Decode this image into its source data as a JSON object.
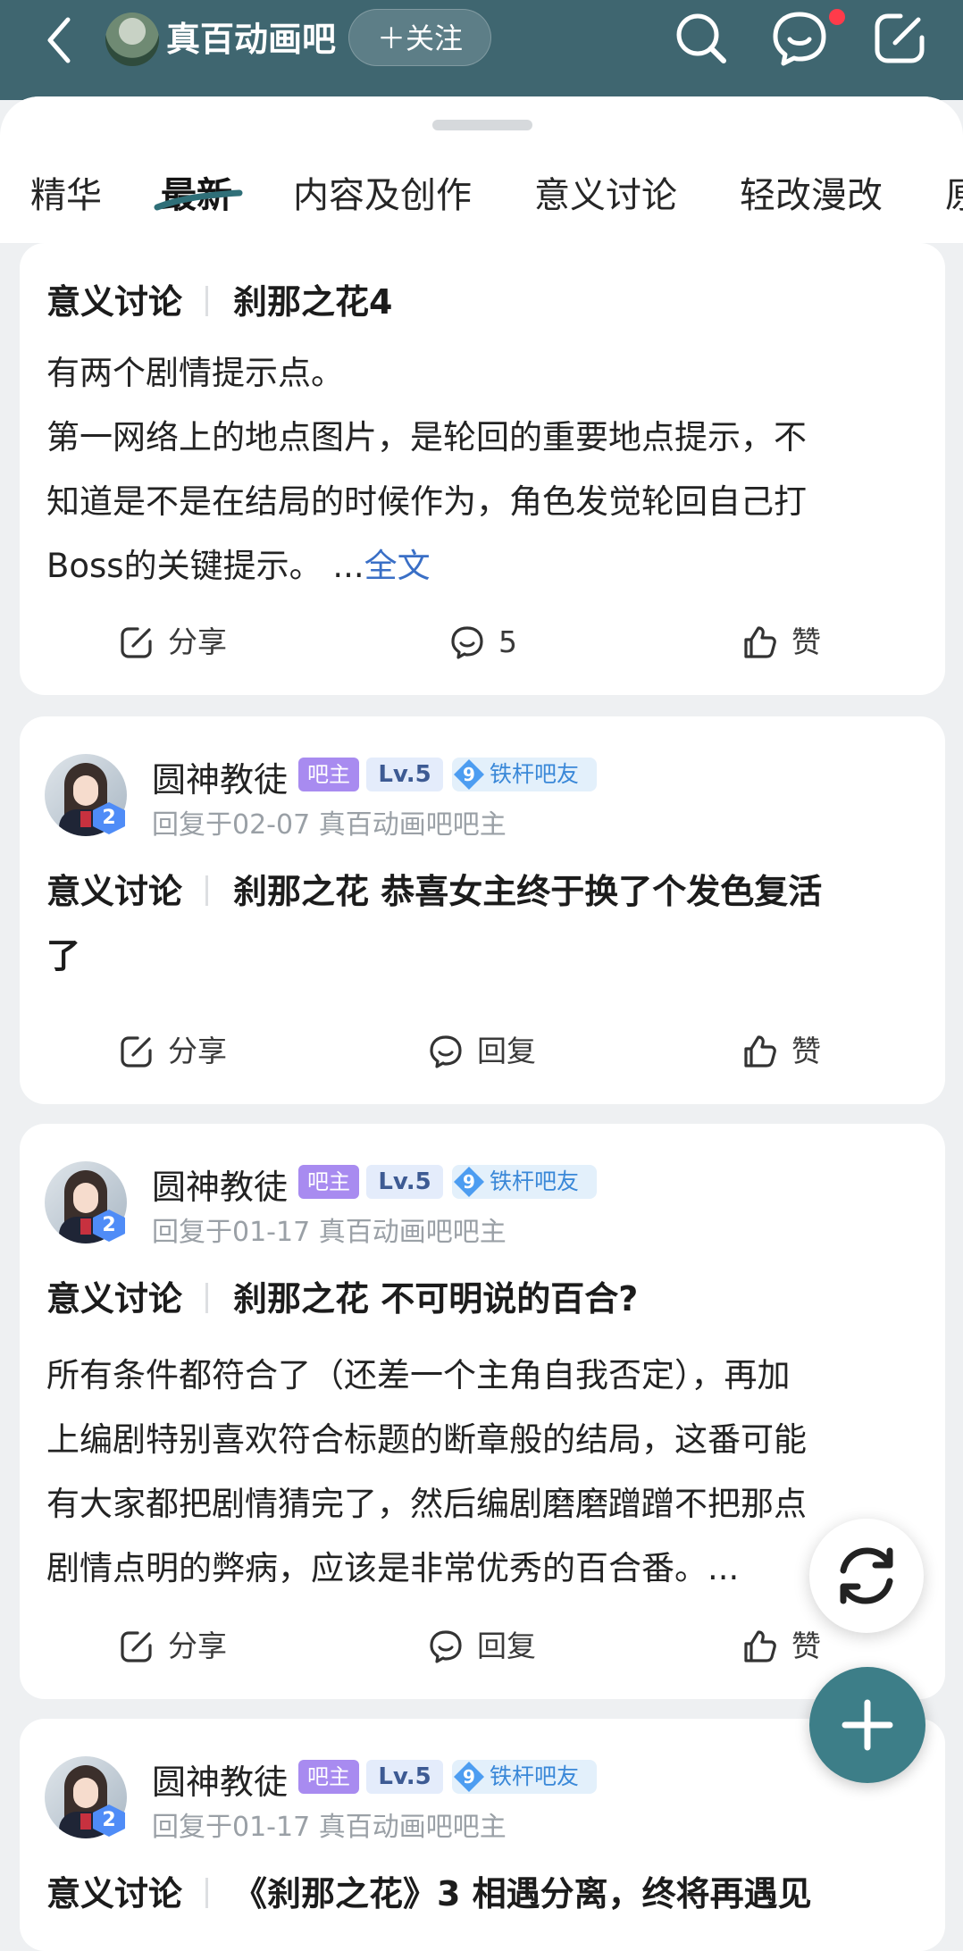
{
  "header": {
    "forum_name": "真百动画吧",
    "follow_label": "＋关注",
    "has_notification": true
  },
  "tabs": [
    {
      "label": "精华"
    },
    {
      "label": "最新"
    },
    {
      "label": "内容及创作"
    },
    {
      "label": "意义讨论"
    },
    {
      "label": "轻改漫改"
    },
    {
      "label": "原"
    }
  ],
  "active_tab": "最新",
  "posts": [
    {
      "category": "意义讨论",
      "title": "刹那之花4",
      "body_lines": [
        "有两个剧情提示点。",
        "第一网络上的地点图片，是轮回的重要地点提示，不",
        "知道是不是在结局的时候作为，角色发觉轮回自己打"
      ],
      "body_last": "Boss的关键提示。 ...",
      "more_label": "全文",
      "share_label": "分享",
      "comment_label": "5",
      "like_label": "赞"
    },
    {
      "user": "圆神教徒",
      "owner_tag": "吧主",
      "level_tag": "Lv.5",
      "fan_level": "9",
      "fan_tag": "铁杆吧友",
      "avatar_badge": "2",
      "meta": "回复于02-07   真百动画吧吧主",
      "category": "意义讨论",
      "title_line1": "刹那之花 恭喜女主终于换了个发色复活",
      "title_line2": "了",
      "share_label": "分享",
      "comment_label": "回复",
      "like_label": "赞"
    },
    {
      "user": "圆神教徒",
      "owner_tag": "吧主",
      "level_tag": "Lv.5",
      "fan_level": "9",
      "fan_tag": "铁杆吧友",
      "avatar_badge": "2",
      "meta": "回复于01-17   真百动画吧吧主",
      "category": "意义讨论",
      "title": "刹那之花 不可明说的百合?",
      "body_lines": [
        "所有条件都符合了（还差一个主角自我否定），再加",
        "上编剧特别喜欢符合标题的断章般的结局，这番可能",
        "有大家都把剧情猜完了，然后编剧磨磨蹭蹭不把那点",
        "剧情点明的弊病，应该是非常优秀的百合番。..."
      ],
      "share_label": "分享",
      "comment_label": "回复",
      "like_label": "赞"
    },
    {
      "user": "圆神教徒",
      "owner_tag": "吧主",
      "level_tag": "Lv.5",
      "fan_level": "9",
      "fan_tag": "铁杆吧友",
      "avatar_badge": "2",
      "meta": "回复于01-17   真百动画吧吧主",
      "category": "意义讨论",
      "title": "《刹那之花》3 相遇分离，终将再遇见"
    }
  ],
  "colors": {
    "header_bg": "#3f6670",
    "accent_link": "#3a6fc6",
    "fab": "#3d7e88",
    "owner_tag": "#a88bf0"
  }
}
